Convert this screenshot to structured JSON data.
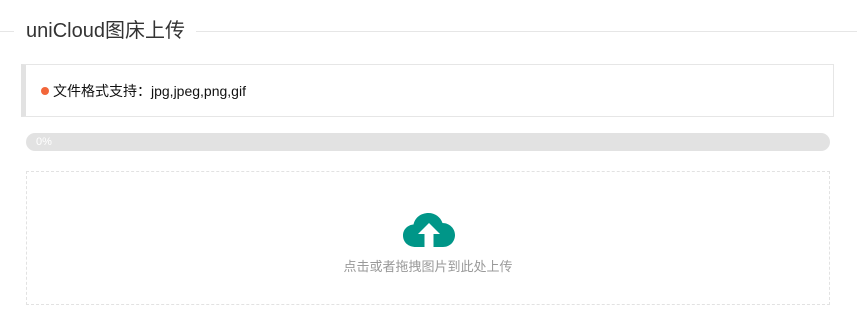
{
  "header": {
    "title": "uniCloud图床上传"
  },
  "tip": {
    "text": "文件格式支持：jpg,jpeg,png,gif",
    "dot_color": "#f2663a"
  },
  "progress": {
    "label": "0%",
    "value": 0
  },
  "upload": {
    "icon": "cloud-upload-icon",
    "icon_color": "#009688",
    "hint": "点击或者拖拽图片到此处上传"
  }
}
